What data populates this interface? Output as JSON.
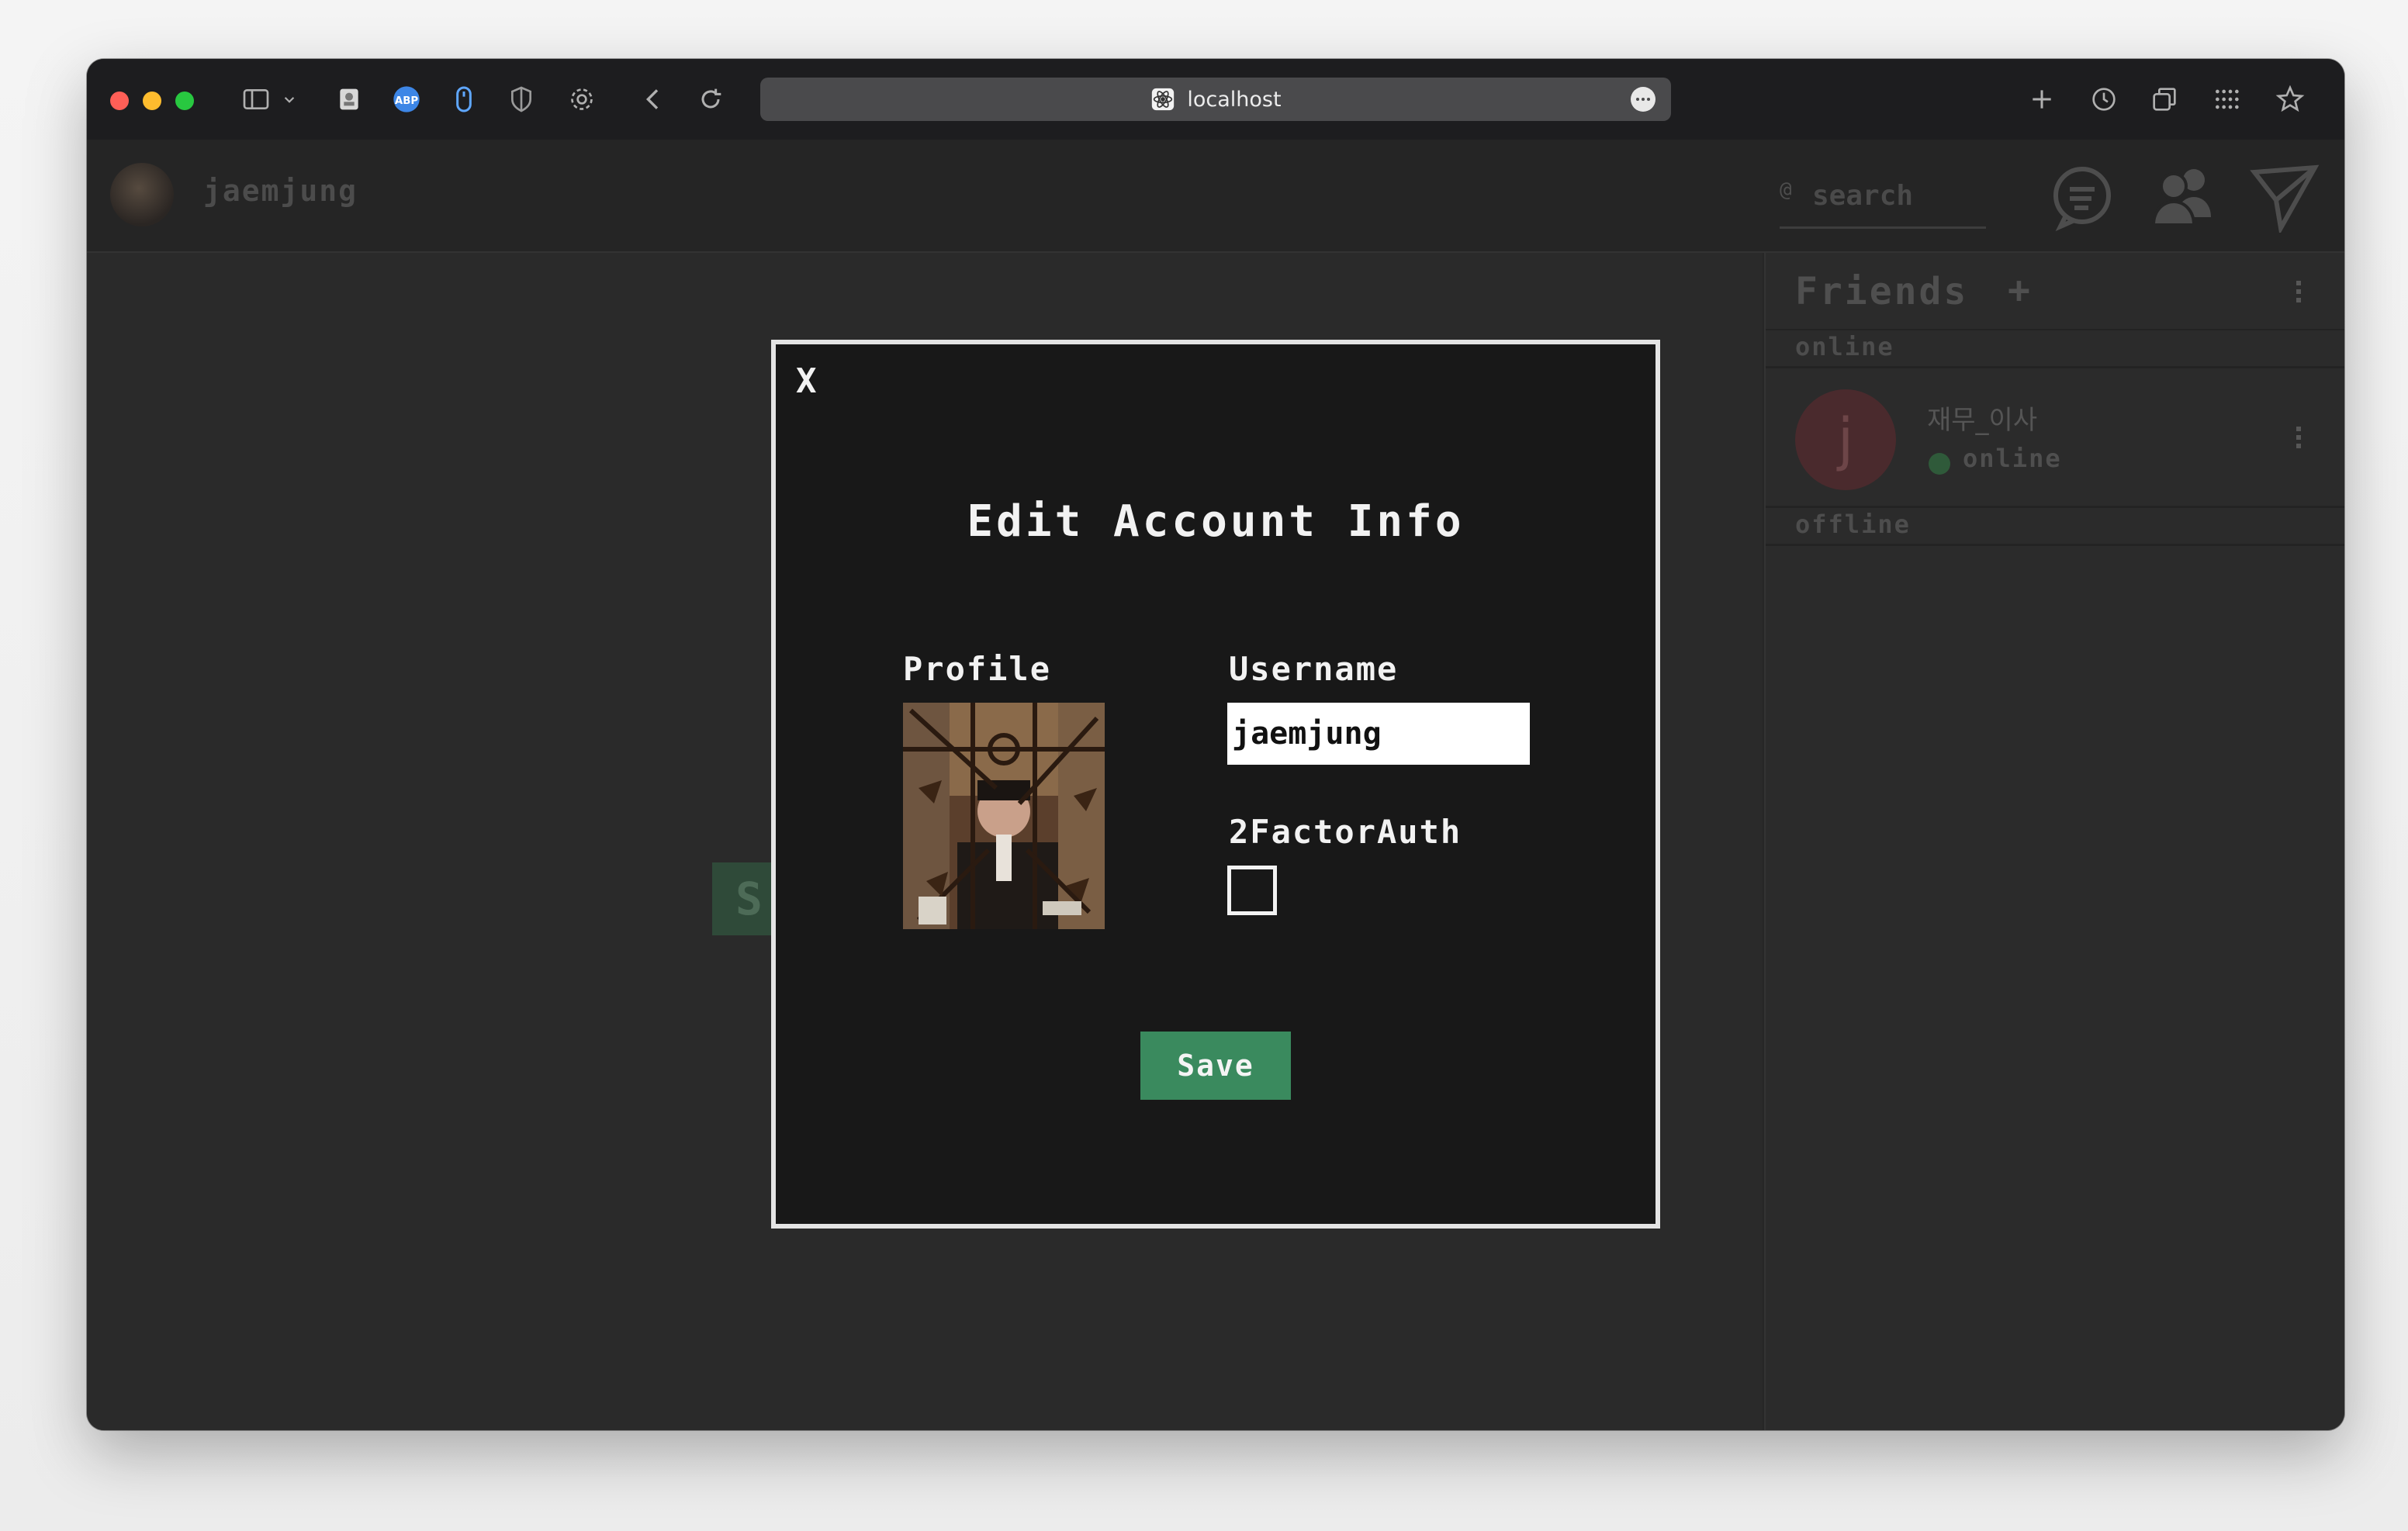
{
  "browser": {
    "url": "localhost",
    "traffic_lights": {
      "close": "#ff5f57",
      "minimize": "#febc2e",
      "zoom": "#28c840"
    },
    "toolbar_icons": [
      "sidebar-icon",
      "chevron-down-icon",
      "contact-card-icon",
      "adblock-icon",
      "mouse-icon",
      "shield-icon",
      "gear-icon",
      "back-icon",
      "reload-icon",
      "new-tab-icon",
      "history-icon",
      "tabs-overview-icon",
      "grid-icon",
      "bookmark-star-icon"
    ]
  },
  "header": {
    "username": "jaemjung",
    "search": {
      "prefix": "@",
      "placeholder": "search"
    },
    "icons": [
      "chat-icon",
      "friends-icon",
      "send-icon"
    ]
  },
  "background": {
    "start_button_fragment": "S",
    "accent": "#3a8a5e"
  },
  "friends": {
    "title": "Friends",
    "add": "+",
    "sections": {
      "online": "online",
      "offline": "offline"
    },
    "items": [
      {
        "avatar_letter": "j",
        "name": "재무_이사",
        "status": "online",
        "status_color": "#2f5a3a"
      }
    ]
  },
  "modal": {
    "close": "X",
    "title": "Edit Account Info",
    "profile_label": "Profile",
    "username_label": "Username",
    "username_value": "jaemjung",
    "twofa_label": "2FactorAuth",
    "twofa_checked": false,
    "save_label": "Save",
    "save_color": "#3a8a5e"
  }
}
